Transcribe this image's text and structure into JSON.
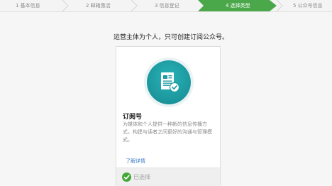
{
  "steps": [
    {
      "label": "1 基本信息"
    },
    {
      "label": "2 邮箱激活"
    },
    {
      "label": "3 信息登记"
    },
    {
      "label": "4 选择类型"
    },
    {
      "label": "5 公众号信息"
    }
  ],
  "active_step_index": 3,
  "colors": {
    "active_step": "#4aa84a",
    "teal_icon": "#1d9aa0",
    "check_green": "#41a838",
    "link_blue": "#3d7bc6"
  },
  "subtitle": "运营主体为个人，只可创建订阅公众号。",
  "card": {
    "icon": "subscription-document-icon",
    "title": "订阅号",
    "description": "为媒体和个人提供一种新的信息传播方式，构建与读者之间更好的沟通与管理模式。",
    "link_label": "了解详情",
    "selected_label": "已选择",
    "selected_icon": "check-circle-icon"
  }
}
